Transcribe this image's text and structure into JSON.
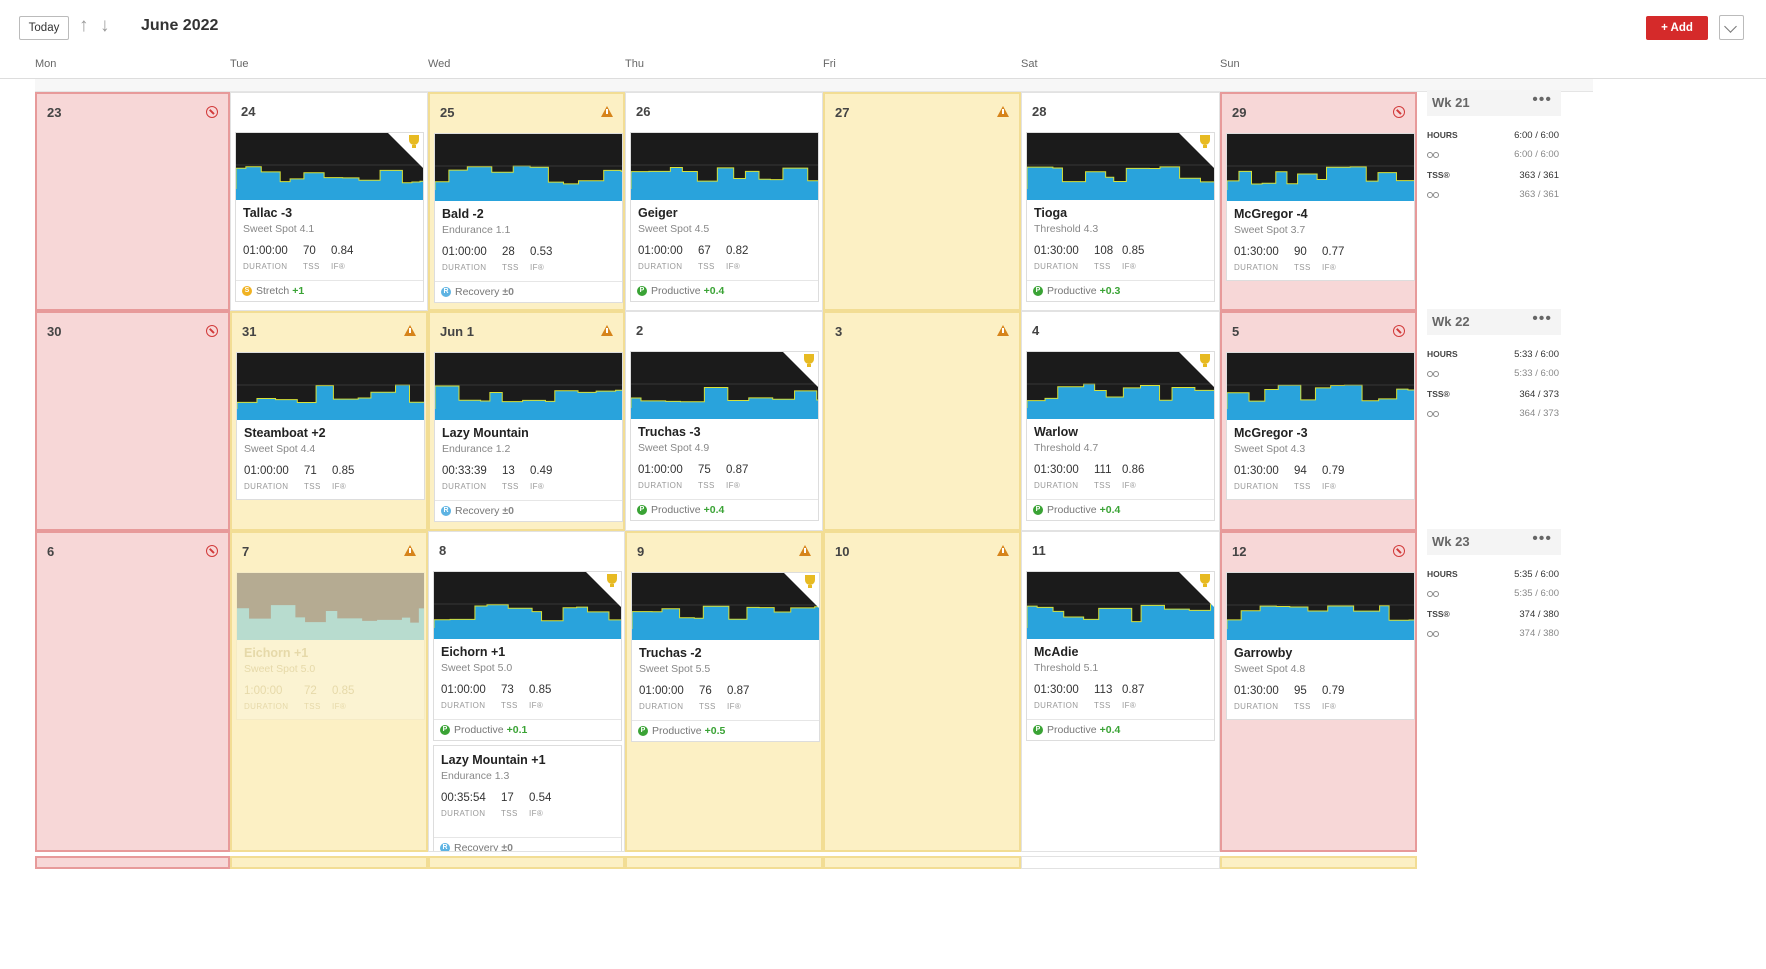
{
  "toolbar": {
    "today_label": "Today",
    "up_arrow": "↑",
    "down_arrow": "↓",
    "month_title": "June 2022",
    "add_label": "+ Add"
  },
  "days": [
    "Mon",
    "Tue",
    "Wed",
    "Thu",
    "Fri",
    "Sat",
    "Sun"
  ],
  "weeks": [
    {
      "label": "Wk 21",
      "hours_label": "HOURS",
      "hours": "6:00 / 6:00",
      "hours_bike": "6:00 / 6:00",
      "tss_label": "TSS®",
      "tss": "363 / 361",
      "tss_bike": "363 / 361",
      "cells": [
        {
          "date": "23",
          "style": "red",
          "icon": "block"
        },
        {
          "date": "24",
          "style": "blank",
          "icon": "",
          "workout": {
            "title": "Tallac -3",
            "subtitle": "Sweet Spot 4.1",
            "duration": "01:00:00",
            "tss": "70",
            "if": "0.84",
            "trophy": true,
            "status": {
              "type": "S",
              "label": "Stretch",
              "delta": "+1"
            }
          }
        },
        {
          "date": "25",
          "style": "yellow",
          "icon": "warn",
          "workout": {
            "title": "Bald -2",
            "subtitle": "Endurance 1.1",
            "duration": "01:00:00",
            "tss": "28",
            "if": "0.53",
            "trophy": false,
            "status": {
              "type": "R",
              "label": "Recovery",
              "delta": "±0"
            }
          }
        },
        {
          "date": "26",
          "style": "blank",
          "icon": "",
          "workout": {
            "title": "Geiger",
            "subtitle": "Sweet Spot 4.5",
            "duration": "01:00:00",
            "tss": "67",
            "if": "0.82",
            "trophy": false,
            "status": {
              "type": "P",
              "label": "Productive",
              "delta": "+0.4"
            }
          }
        },
        {
          "date": "27",
          "style": "yellow",
          "icon": "warn"
        },
        {
          "date": "28",
          "style": "blank",
          "icon": "",
          "workout": {
            "title": "Tioga",
            "subtitle": "Threshold 4.3",
            "duration": "01:30:00",
            "tss": "108",
            "if": "0.85",
            "trophy": true,
            "status": {
              "type": "P",
              "label": "Productive",
              "delta": "+0.3"
            }
          }
        },
        {
          "date": "29",
          "style": "red",
          "icon": "block",
          "workout": {
            "title": "McGregor -4",
            "subtitle": "Sweet Spot 3.7",
            "duration": "01:30:00",
            "tss": "90",
            "if": "0.77",
            "trophy": false
          }
        }
      ]
    },
    {
      "label": "Wk 22",
      "hours_label": "HOURS",
      "hours": "5:33 / 6:00",
      "hours_bike": "5:33 / 6:00",
      "tss_label": "TSS®",
      "tss": "364 / 373",
      "tss_bike": "364 / 373",
      "cells": [
        {
          "date": "30",
          "style": "red",
          "icon": "block"
        },
        {
          "date": "31",
          "style": "yellow",
          "icon": "warn",
          "workout": {
            "title": "Steamboat +2",
            "subtitle": "Sweet Spot 4.4",
            "duration": "01:00:00",
            "tss": "71",
            "if": "0.85",
            "trophy": false
          }
        },
        {
          "date": "Jun 1",
          "style": "yellow",
          "icon": "warn",
          "workout": {
            "title": "Lazy Mountain",
            "subtitle": "Endurance 1.2",
            "duration": "00:33:39",
            "tss": "13",
            "if": "0.49",
            "trophy": false,
            "status": {
              "type": "R",
              "label": "Recovery",
              "delta": "±0"
            }
          }
        },
        {
          "date": "2",
          "style": "blank",
          "icon": "",
          "workout": {
            "title": "Truchas -3",
            "subtitle": "Sweet Spot 4.9",
            "duration": "01:00:00",
            "tss": "75",
            "if": "0.87",
            "trophy": true,
            "status": {
              "type": "P",
              "label": "Productive",
              "delta": "+0.4"
            }
          }
        },
        {
          "date": "3",
          "style": "yellow",
          "icon": "warn"
        },
        {
          "date": "4",
          "style": "blank",
          "icon": "",
          "workout": {
            "title": "Warlow",
            "subtitle": "Threshold 4.7",
            "duration": "01:30:00",
            "tss": "111",
            "if": "0.86",
            "trophy": true,
            "status": {
              "type": "P",
              "label": "Productive",
              "delta": "+0.4"
            }
          }
        },
        {
          "date": "5",
          "style": "red",
          "icon": "block",
          "workout": {
            "title": "McGregor -3",
            "subtitle": "Sweet Spot 4.3",
            "duration": "01:30:00",
            "tss": "94",
            "if": "0.79",
            "trophy": false
          }
        }
      ]
    },
    {
      "label": "Wk 23",
      "hours_label": "HOURS",
      "hours": "5:35 / 6:00",
      "hours_bike": "5:35 / 6:00",
      "tss_label": "TSS®",
      "tss": "374 / 380",
      "tss_bike": "374 / 380",
      "cells": [
        {
          "date": "6",
          "style": "red",
          "icon": "block"
        },
        {
          "date": "7",
          "style": "yellow",
          "icon": "warn",
          "workout": {
            "title": "Eichorn +1",
            "subtitle": "Sweet Spot 5.0",
            "duration": "1:00:00",
            "tss": "72",
            "if": "0.85",
            "trophy": false,
            "muted": true
          }
        },
        {
          "date": "8",
          "style": "blank",
          "icon": "",
          "workout": {
            "title": "Eichorn +1",
            "subtitle": "Sweet Spot 5.0",
            "duration": "01:00:00",
            "tss": "73",
            "if": "0.85",
            "trophy": true,
            "status": {
              "type": "P",
              "label": "Productive",
              "delta": "+0.1"
            }
          },
          "extra": {
            "title": "Lazy Mountain +1",
            "subtitle": "Endurance 1.3",
            "duration": "00:35:54",
            "tss": "17",
            "if": "0.54",
            "status": {
              "type": "R",
              "label": "Recovery",
              "delta": "±0"
            }
          }
        },
        {
          "date": "9",
          "style": "yellow",
          "icon": "warn",
          "workout": {
            "title": "Truchas -2",
            "subtitle": "Sweet Spot 5.5",
            "duration": "01:00:00",
            "tss": "76",
            "if": "0.87",
            "trophy": true,
            "status": {
              "type": "P",
              "label": "Productive",
              "delta": "+0.5"
            }
          }
        },
        {
          "date": "10",
          "style": "yellow",
          "icon": "warn"
        },
        {
          "date": "11",
          "style": "blank",
          "icon": "",
          "workout": {
            "title": "McAdie",
            "subtitle": "Threshold 5.1",
            "duration": "01:30:00",
            "tss": "113",
            "if": "0.87",
            "trophy": true,
            "status": {
              "type": "P",
              "label": "Productive",
              "delta": "+0.4"
            }
          }
        },
        {
          "date": "12",
          "style": "red",
          "icon": "block",
          "workout": {
            "title": "Garrowby",
            "subtitle": "Sweet Spot 4.8",
            "duration": "01:30:00",
            "tss": "95",
            "if": "0.79",
            "trophy": false
          }
        }
      ]
    }
  ],
  "metric_labels": {
    "duration": "DURATION",
    "tss": "TSS",
    "if": "IF®"
  },
  "colors": {
    "red_bg": "#f7d7d7",
    "yellow_bg": "#fcf0c4",
    "accent_add": "#d52a2a",
    "chart_fill": "#29a3dc",
    "chart_line": "#d6e13a",
    "productive": "#3aa335",
    "recovery": "#5db3e3",
    "stretch": "#f0b222",
    "block": "#d23a3a",
    "warn": "#d6841b"
  }
}
